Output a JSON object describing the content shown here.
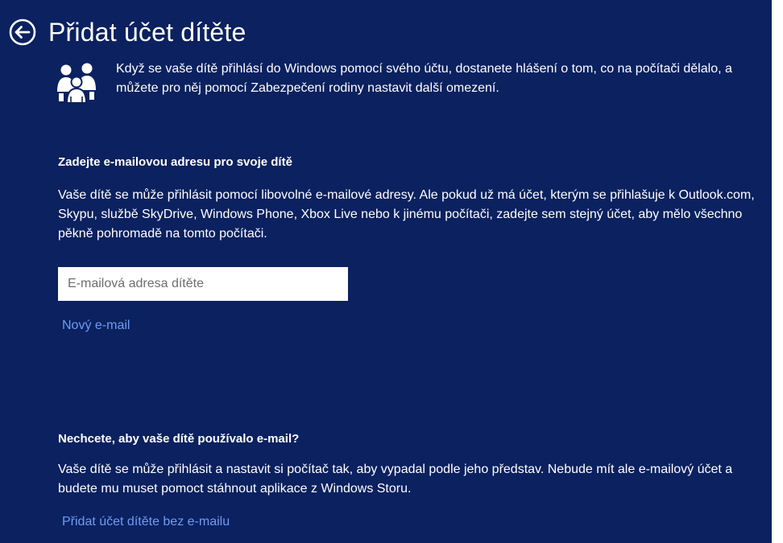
{
  "header": {
    "back_icon": "back-arrow-icon",
    "title": "Přidat účet dítěte"
  },
  "intro": {
    "icon": "family-icon",
    "text": "Když se vaše dítě přihlásí do Windows pomocí svého účtu, dostanete hlášení o tom, co na počítači dělalo, a můžete pro něj pomocí Zabezpečení rodiny nastavit další omezení."
  },
  "email_section": {
    "heading": "Zadejte e-mailovou adresu pro svoje dítě",
    "description": "Vaše dítě se může přihlásit pomocí libovolné e-mailové adresy. Ale pokud už má účet, kterým se přihlašuje k Outlook.com, Skypu, službě SkyDrive, Windows Phone, Xbox Live nebo k jinému počítači, zadejte sem stejný účet, aby mělo všechno pěkně pohromadě na tomto počítači.",
    "input_placeholder": "E-mailová adresa dítěte",
    "input_value": "",
    "new_email_link": "Nový e-mail"
  },
  "no_email_section": {
    "heading": "Nechcete, aby vaše dítě používalo e-mail?",
    "description": "Vaše dítě se může přihlásit a nastavit si počítač tak, aby vypadal podle jeho představ. Nebude mít ale e-mailový účet a budete mu muset pomoct stáhnout aplikace z Windows Storu.",
    "add_without_email_link": "Přidat účet dítěte bez e-mailu"
  },
  "colors": {
    "background": "#0b2160",
    "text": "#ffffff",
    "link": "#6f9cf0"
  }
}
